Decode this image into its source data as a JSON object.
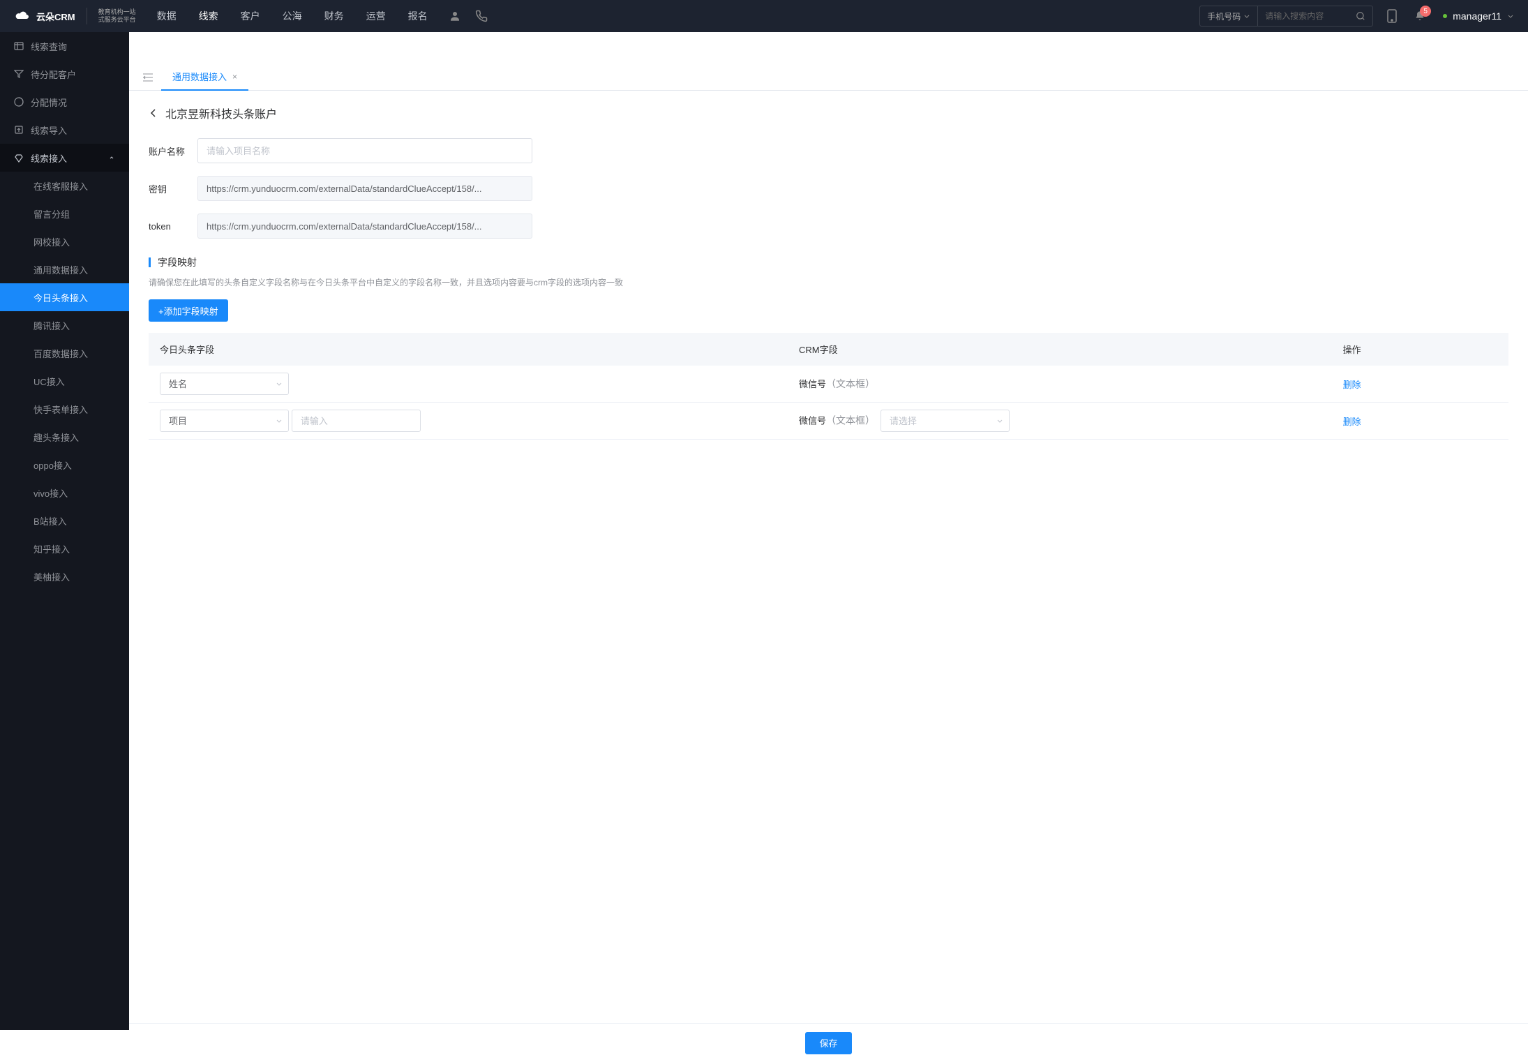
{
  "header": {
    "logo_brand": "云朵CRM",
    "logo_sub1": "教育机构一站",
    "logo_sub2": "式服务云平台",
    "nav": [
      "数据",
      "线索",
      "客户",
      "公海",
      "财务",
      "运营",
      "报名"
    ],
    "nav_active": 1,
    "search_type": "手机号码",
    "search_placeholder": "请输入搜索内容",
    "notif_count": "5",
    "username": "manager11"
  },
  "sidebar": {
    "items": [
      {
        "label": "线索查询"
      },
      {
        "label": "待分配客户"
      },
      {
        "label": "分配情况"
      },
      {
        "label": "线索导入"
      },
      {
        "label": "线索接入",
        "expanded": true,
        "children": [
          {
            "label": "在线客服接入"
          },
          {
            "label": "留言分组"
          },
          {
            "label": "网校接入"
          },
          {
            "label": "通用数据接入"
          },
          {
            "label": "今日头条接入",
            "active": true
          },
          {
            "label": "腾讯接入"
          },
          {
            "label": "百度数据接入"
          },
          {
            "label": "UC接入"
          },
          {
            "label": "快手表单接入"
          },
          {
            "label": "趣头条接入"
          },
          {
            "label": "oppo接入"
          },
          {
            "label": "vivo接入"
          },
          {
            "label": "B站接入"
          },
          {
            "label": "知乎接入"
          },
          {
            "label": "美柚接入"
          }
        ]
      }
    ]
  },
  "tab": {
    "label": "通用数据接入"
  },
  "page": {
    "title": "北京昱新科技头条账户",
    "form": {
      "account_label": "账户名称",
      "account_placeholder": "请输入项目名称",
      "secret_label": "密钥",
      "secret_value": "https://crm.yunduocrm.com/externalData/standardClueAccept/158/...",
      "token_label": "token",
      "token_value": "https://crm.yunduocrm.com/externalData/standardClueAccept/158/..."
    },
    "mapping": {
      "title": "字段映射",
      "desc": "请确保您在此填写的头条自定义字段名称与在今日头条平台中自定义的字段名称一致，并且选项内容要与crm字段的选项内容一致",
      "add_btn": "+添加字段映射",
      "columns": {
        "toutiao": "今日头条字段",
        "crm": "CRM字段",
        "action": "操作"
      },
      "rows": [
        {
          "toutiao_select": "姓名",
          "crm_label": "微信号",
          "crm_hint": "（文本框）",
          "show_input": false,
          "show_crm_select": false,
          "delete": "删除"
        },
        {
          "toutiao_select": "项目",
          "input_placeholder": "请输入",
          "crm_label": "微信号",
          "crm_hint": "（文本框）",
          "crm_select_placeholder": "请选择",
          "show_input": true,
          "show_crm_select": true,
          "delete": "删除"
        }
      ]
    },
    "save": "保存"
  }
}
